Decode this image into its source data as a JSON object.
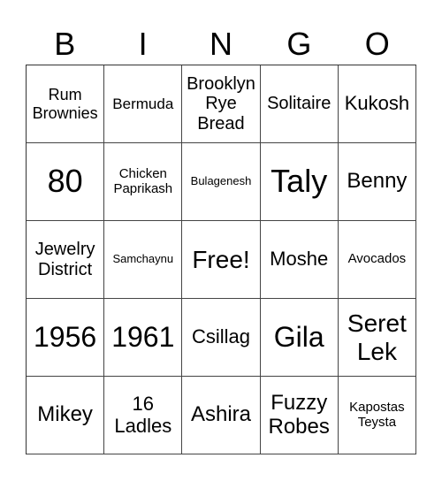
{
  "header": [
    "B",
    "I",
    "N",
    "G",
    "O"
  ],
  "cells": [
    [
      "Rum Brownies",
      "Bermuda",
      "Brooklyn Rye Bread",
      "Solitaire",
      "Kukosh"
    ],
    [
      "80",
      "Chicken Paprikash",
      "Bulagenesh",
      "Taly",
      "Benny"
    ],
    [
      "Jewelry District",
      "Samchaynu",
      "Free!",
      "Moshe",
      "Avocados"
    ],
    [
      "1956",
      "1961",
      "Csillag",
      "Gila",
      "Seret Lek"
    ],
    [
      "Mikey",
      "16 Ladles",
      "Ashira",
      "Fuzzy Robes",
      "Kapostas Teysta"
    ]
  ]
}
